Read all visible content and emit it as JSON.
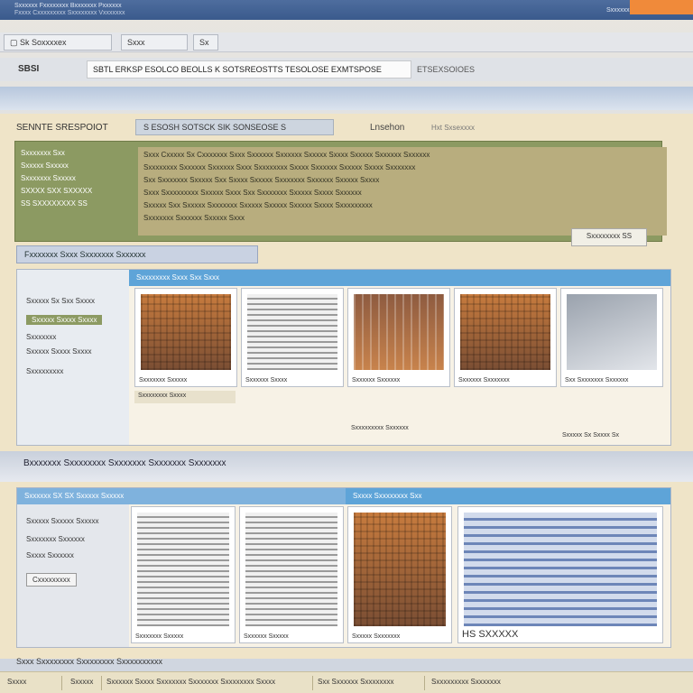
{
  "window": {
    "title_line1": "Sxxxxxx Fxxxxxxxx Bxxxxxxx Pxxxxxx",
    "title_line2": "Fxxxx Cxxxxxxxxx Sxxxxxxxx Vxxxxxxx",
    "meta": "Sxxxxxx",
    "accent_color": "#f08a3a"
  },
  "tabs": [
    {
      "label": "Sk Soxxxxex"
    },
    {
      "label": "Sxxx"
    },
    {
      "label": "Sx"
    }
  ],
  "address": {
    "label": "SBSI",
    "value": "SBTL ERKSP ESOLCO BEOLLS K SOTSREOSTTS TESOLOSE EXMTSPOSE",
    "extra": "ETSEXSOIOES"
  },
  "main": {
    "header_label": "SENNTE SRESPOIOT",
    "search_pill": "S ESOSH SOTSCK SIK SONSEOSE S",
    "header_link": "Lnsehon",
    "header_note": "Hxt Sxsexxxx"
  },
  "notice": {
    "side_lines": [
      "Sxxxxxxx Sxx",
      "Sxxxxx Sxxxxx",
      "Sxxxxxxx Sxxxxx",
      "SXXXX SXX SXXXXX",
      "SS SXXXXXXXX SS"
    ],
    "body_lines": [
      "Sxxx Cxxxxx Sx Cxxxxxxx Sxxx Sxxxxxx Sxxxxxx Sxxxxx Sxxxx Sxxxxx Sxxxxxx Sxxxxxx",
      "Sxxxxxxxx Sxxxxxx Sxxxxxx Sxxx Sxxxxxxxx Sxxxx Sxxxxxx Sxxxxx Sxxxx Sxxxxxxx",
      "Sxx Sxxxxxxx Sxxxxx Sxx Sxxxx Sxxxxx Sxxxxxxx Sxxxxxx Sxxxxx Sxxxx",
      "Sxxx Sxxxxxxxxx Sxxxxx Sxxx Sxx Sxxxxxxx Sxxxxx Sxxxx Sxxxxxx",
      "Sxxxxx Sxx Sxxxxx Sxxxxxxx Sxxxxx Sxxxxx Sxxxxx Sxxxx Sxxxxxxxxx",
      "Sxxxxxxx Sxxxxxx Sxxxxx Sxxx"
    ],
    "button": "Sxxxxxxxx SS"
  },
  "gallery1": {
    "section_header": "Fxxxxxxx Sxxx Sxxxxxxx Sxxxxxx",
    "left_items": [
      "Sxxxxx Sx Sxx Sxxxx",
      "Sxxxxx Sxxxx Sxxxx",
      "Sxxxxxxx",
      "Sxxxxx Sxxxx  Sxxxx",
      "Sxxxxxxxxx"
    ],
    "header": "Sxxxxxxxx Sxxx Sxx Sxxx",
    "cards": [
      {
        "caption": "Sxxxxxxx Sxxxxx"
      },
      {
        "caption": "Sxxxxxx Sxxxx"
      },
      {
        "caption": "Sxxxxxx Sxxxxxx"
      },
      {
        "caption": "Sxxxxxx Sxxxxxxx"
      },
      {
        "caption": "Sxx Sxxxxxxx Sxxxxxx"
      }
    ],
    "footer_left": "Sxxxxxxxx Sxxxx",
    "footer_mid": "Sxxxxxxxxx Sxxxxxx",
    "footer_right": "Sxxxxx Sx Sxxxx Sx"
  },
  "section2_title": "Bxxxxxxx Sxxxxxxxx Sxxxxxxx Sxxxxxxx Sxxxxxxx",
  "gallery2": {
    "left_items": [
      "Sxxxxx Sxxxxx Sxxxxx",
      "Sxxxxxxx Sxxxxxx",
      "Sxxxx Sxxxxxx"
    ],
    "left_button": "Cxxxxxxxxx",
    "header_left": "Sxxxxxx SX SX Sxxxxx Sxxxxx",
    "header_mid": "Sxxxx Sxxxxxxxx Sxx",
    "cards": [
      {
        "caption": "Sxxxxxxx Sxxxxx"
      },
      {
        "caption": "Sxxxxxx Sxxxxx"
      },
      {
        "caption": "Sxxxxx Sxxxxxxx"
      },
      {
        "caption": "HS SXXXXX"
      }
    ]
  },
  "bottom_heading": "Sxxx Sxxxxxxxx Sxxxxxxxx Sxxxxxxxxxx",
  "status": [
    {
      "text": "Sxxxx"
    },
    {
      "text": "Sxxxxx"
    },
    {
      "text": "Sxxxxxx Sxxxx Sxxxxxxx Sxxxxxxx Sxxxxxxxx Sxxxx"
    },
    {
      "text": "Sxx Sxxxxxx Sxxxxxxxx"
    },
    {
      "text": "Sxxxxxxxxx Sxxxxxxx"
    }
  ]
}
